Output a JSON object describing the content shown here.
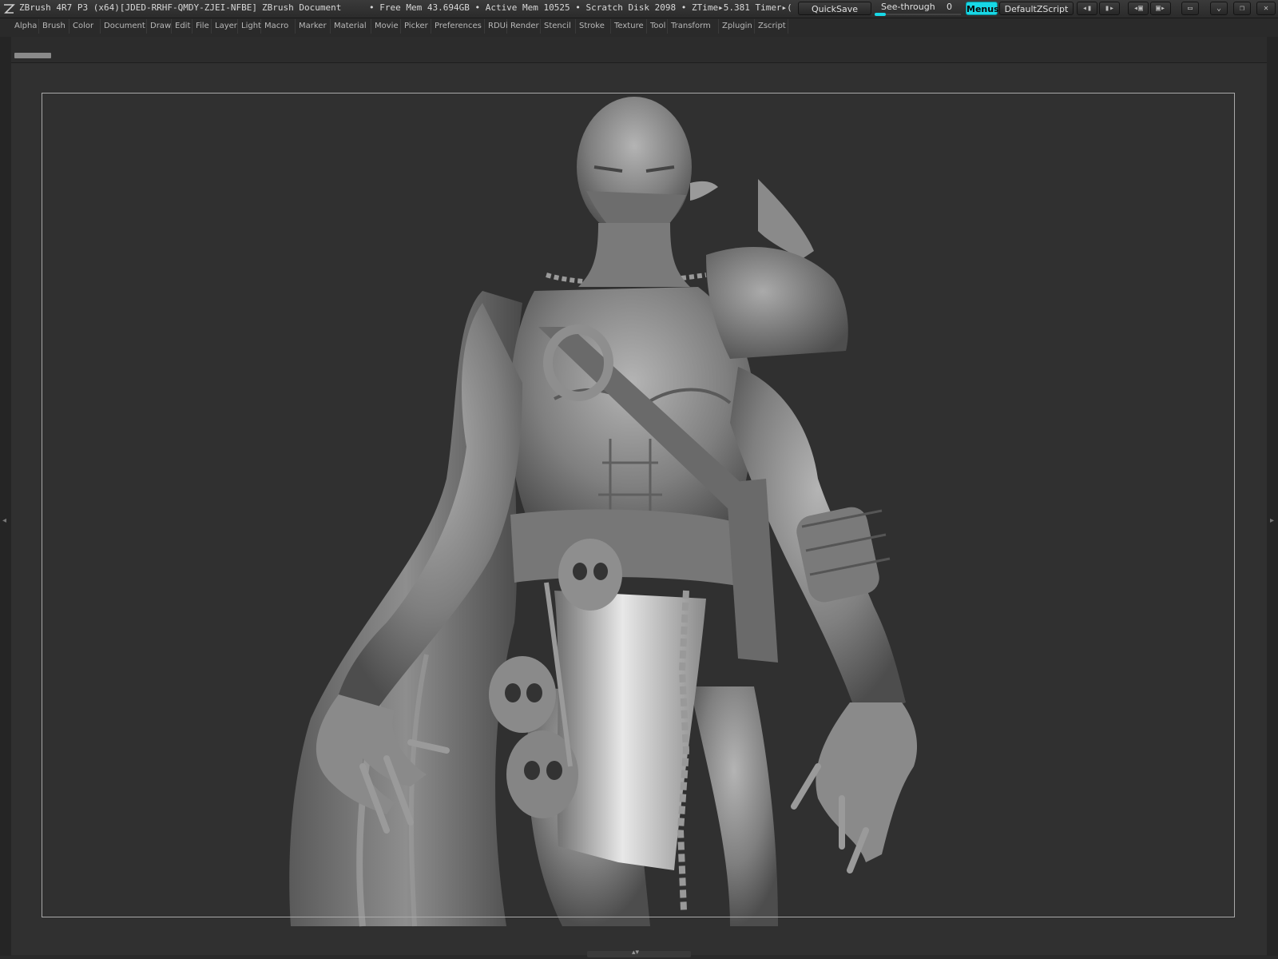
{
  "titlebar": {
    "app_title": "ZBrush 4R7 P3 (x64)[JDED-RRHF-QMDY-ZJEI-NFBE]",
    "document_title": "ZBrush Document",
    "stats": "• Free Mem 43.694GB • Active Mem 10525 • Scratch Disk 2098 • ZTime▸5.381 Timer▸(",
    "quicksave_label": "QuickSave",
    "seethrough_label": "See-through",
    "seethrough_value": "0",
    "seethrough_level": 0,
    "menus_label": "Menus",
    "script_label": "DefaultZScript"
  },
  "menubar": {
    "items": [
      "Alpha",
      "Brush",
      "Color",
      "Document",
      "Draw",
      "Edit",
      "File",
      "Layer",
      "Light",
      "Macro",
      "Marker",
      "Material",
      "Movie",
      "Picker",
      "Preferences",
      "RDUi",
      "Render",
      "Stencil",
      "Stroke",
      "Texture",
      "Tool",
      "Transform",
      "Zplugin",
      "Zscript"
    ]
  },
  "colors": {
    "accent": "#18d8e6",
    "background": "#2a2a2a",
    "canvas": "#303030",
    "model": "#8c8c8c"
  },
  "icons": {
    "logo": "zbrush-logo-icon",
    "minimize": "minimize-icon",
    "restore": "restore-icon",
    "close": "close-icon",
    "lock": "lock-icon"
  }
}
